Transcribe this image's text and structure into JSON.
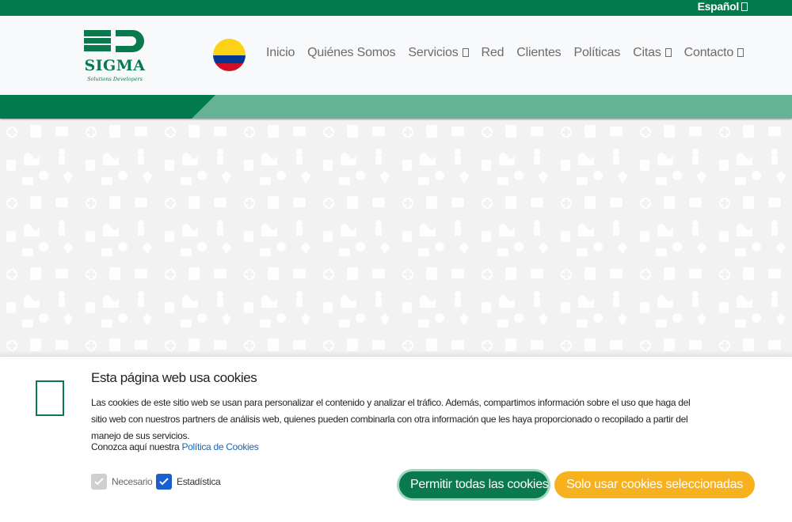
{
  "topbar": {
    "language": "Español"
  },
  "brand": {
    "name": "SIGMA",
    "tagline": "Solutions Developers",
    "primary_color": "#0a7a4e",
    "accent_color": "#63b394"
  },
  "flag": {
    "icon": "colombia-flag-icon"
  },
  "nav": {
    "items": [
      {
        "label": "Inicio",
        "dropdown": false
      },
      {
        "label": "Quiénes Somos",
        "dropdown": false
      },
      {
        "label": "Servicios",
        "dropdown": true
      },
      {
        "label": "Red",
        "dropdown": false
      },
      {
        "label": "Clientes",
        "dropdown": false
      },
      {
        "label": "Políticas",
        "dropdown": false
      },
      {
        "label": "Citas",
        "dropdown": true
      },
      {
        "label": "Contacto",
        "dropdown": true
      }
    ]
  },
  "cookie": {
    "title": "Esta página web usa cookies",
    "text": "Las cookies de este sitio web se usan para personalizar el contenido y analizar el tráfico. Además, compartimos información sobre el uso que haga del sitio web con nuestros partners de análisis web, quienes pueden combinarla con otra información que les haya proporcionado o recopilado a partir del manejo de sus servicios.",
    "policy_prefix": "Conozca aquí nuestra",
    "policy_link": "Política de Cookies",
    "options": {
      "necesario": {
        "label": "Necesario",
        "checked": true,
        "disabled": true
      },
      "estadistica": {
        "label": "Estadística",
        "checked": true,
        "disabled": false
      }
    },
    "buttons": {
      "allow_all": "Permitir todas las cookies",
      "selected_only": "Solo usar cookies seleccionadas"
    },
    "colors": {
      "allow_all": "#0a7a4e",
      "selected_only": "#f7b11e"
    }
  }
}
